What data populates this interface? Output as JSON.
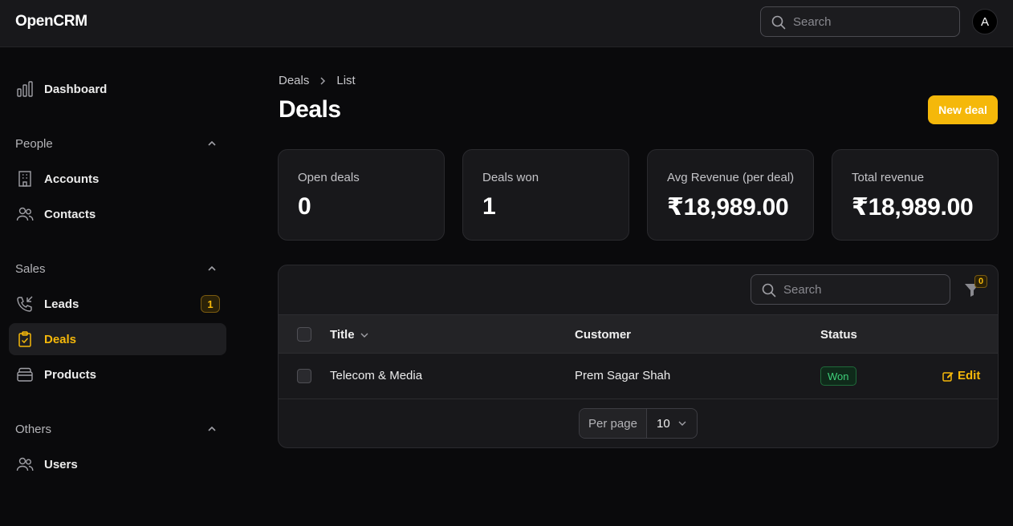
{
  "app": {
    "brand": "OpenCRM",
    "avatar_initial": "A"
  },
  "topbar": {
    "search_placeholder": "Search"
  },
  "sidebar": {
    "dashboard": "Dashboard",
    "groups": {
      "people": {
        "title": "People",
        "items": [
          "Accounts",
          "Contacts"
        ]
      },
      "sales": {
        "title": "Sales",
        "items": [
          "Leads",
          "Deals",
          "Products"
        ],
        "leads_badge": "1"
      },
      "others": {
        "title": "Others",
        "items": [
          "Users"
        ]
      }
    },
    "active_item": "Deals"
  },
  "breadcrumb": [
    "Deals",
    "List"
  ],
  "page": {
    "title": "Deals",
    "new_button": "New deal"
  },
  "stats": [
    {
      "label": "Open deals",
      "value": "0"
    },
    {
      "label": "Deals won",
      "value": "1"
    },
    {
      "label": "Avg Revenue (per deal)",
      "value": "₹18,989.00"
    },
    {
      "label": "Total revenue",
      "value": "₹18,989.00"
    }
  ],
  "table": {
    "search_placeholder": "Search",
    "filter_count": "0",
    "columns": [
      "Title",
      "Customer",
      "Status"
    ],
    "rows": [
      {
        "title": "Telecom & Media",
        "customer": "Prem Sagar Shah",
        "status": "Won",
        "action": "Edit"
      }
    ],
    "pagination": {
      "label": "Per page",
      "value": "10"
    }
  },
  "colors": {
    "accent": "#f5b80a",
    "won_text": "#3fd07a",
    "background": "#0a0a0c"
  }
}
